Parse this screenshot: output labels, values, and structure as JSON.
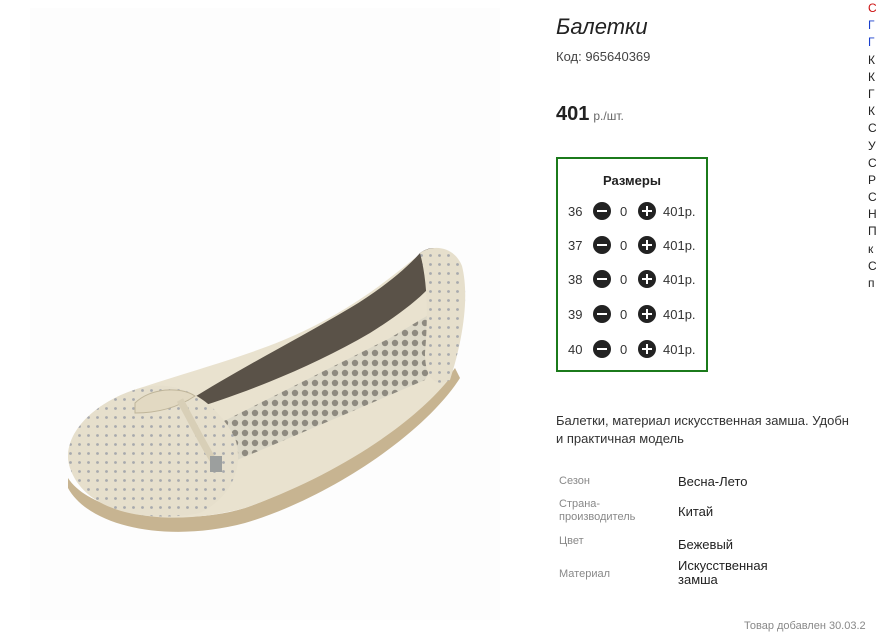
{
  "product": {
    "title": "Балетки",
    "code": "Код: 965640369",
    "price": "401",
    "price_unit": "р./шт."
  },
  "sizes": {
    "title": "Размеры",
    "rows": [
      {
        "size": "36",
        "qty": "0",
        "price": "401р."
      },
      {
        "size": "37",
        "qty": "0",
        "price": "401р."
      },
      {
        "size": "38",
        "qty": "0",
        "price": "401р."
      },
      {
        "size": "39",
        "qty": "0",
        "price": "401р."
      },
      {
        "size": "40",
        "qty": "0",
        "price": "401р."
      }
    ]
  },
  "description": {
    "line1": "Балетки, материал искусственная замша. Удобн",
    "line2": "и практичная модель"
  },
  "specs": [
    {
      "label": "Сезон",
      "value": "Весна-Лето"
    },
    {
      "label": "Страна-производитель",
      "value": "Китай"
    },
    {
      "label": "Цвет",
      "value": "Бежевый"
    },
    {
      "label": "Материал",
      "value": "Искусственная замша"
    }
  ],
  "added_note": "Товар добавлен 30.03.2",
  "edge_letters": [
    "С",
    "Г",
    "Г",
    "К",
    "К",
    "Г",
    "К",
    "С",
    "У",
    "С",
    "Р",
    "С",
    "Н",
    "П",
    "к",
    "С",
    "п"
  ],
  "colors": {
    "accent_border": "#1b7a1b",
    "link_blue": "#1a3fcc",
    "link_red": "#cc1111"
  }
}
